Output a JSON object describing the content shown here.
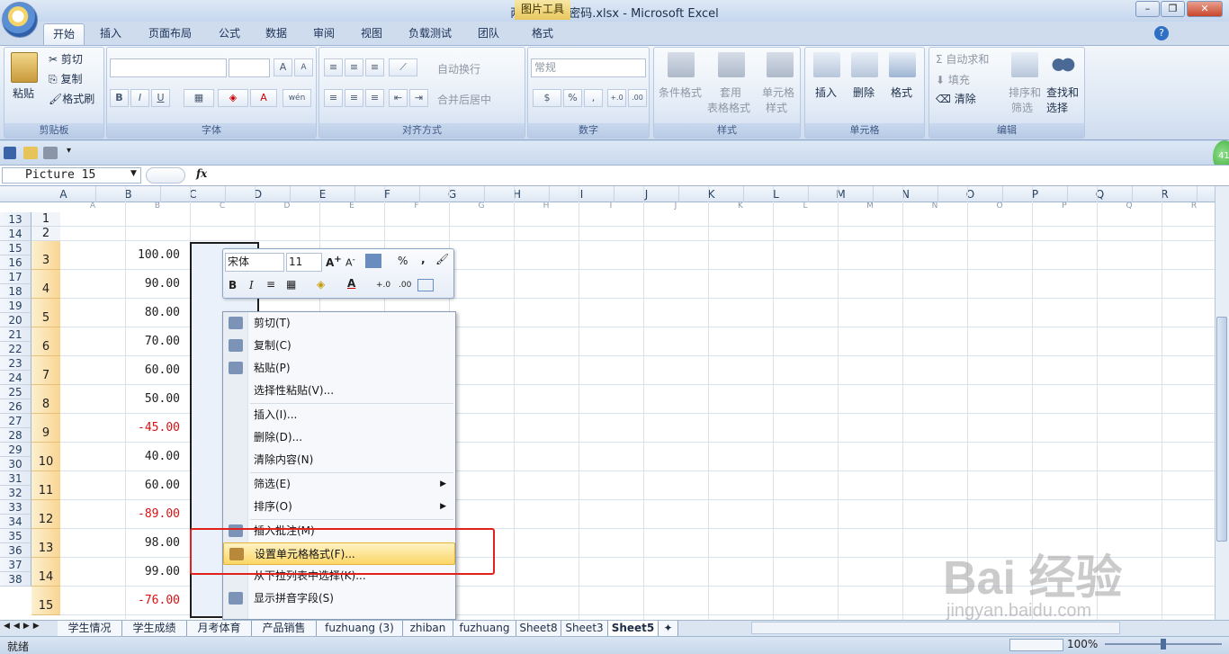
{
  "window": {
    "title": "两小无猜网密码.xlsx - Microsoft Excel",
    "context_tab_group": "图片工具",
    "min_icon": "minimize-icon",
    "max_icon": "restore-icon",
    "close_icon": "close-icon"
  },
  "tabs": [
    "开始",
    "插入",
    "页面布局",
    "公式",
    "数据",
    "审阅",
    "视图",
    "负载测试",
    "团队",
    "格式"
  ],
  "ribbon": {
    "clipboard": {
      "label": "剪贴板",
      "paste": "粘贴",
      "cut": "剪切",
      "copy": "复制",
      "format_painter": "格式刷"
    },
    "font": {
      "label": "字体",
      "bold": "B",
      "italic": "I",
      "underline": "U",
      "grow": "A",
      "shrink": "A",
      "wen": "wén"
    },
    "alignment": {
      "label": "对齐方式",
      "wrap": "自动换行",
      "merge": "合并后居中"
    },
    "number": {
      "label": "数字",
      "format": "常规",
      "percent": "%",
      "comma": ","
    },
    "styles": {
      "label": "样式",
      "conditional": "条件格式",
      "table_line1": "套用",
      "table_line2": "表格格式",
      "cell_line1": "单元格",
      "cell_line2": "样式"
    },
    "cells": {
      "label": "单元格",
      "insert": "插入",
      "delete": "删除",
      "format": "格式"
    },
    "editing": {
      "label": "编辑",
      "autosum": "自动求和",
      "fill": "填充",
      "clear": "清除",
      "sort_line1": "排序和",
      "sort_line2": "筛选",
      "find_line1": "查找和",
      "find_line2": "选择"
    }
  },
  "formula_bar": {
    "name_box": "Picture 15",
    "fx": "fx",
    "formula": ""
  },
  "columns_top": [
    "A",
    "B",
    "C",
    "D",
    "E",
    "F",
    "G",
    "H",
    "I",
    "J",
    "K",
    "L",
    "M",
    "N",
    "O",
    "P",
    "Q",
    "R"
  ],
  "columns_inner": [
    "A",
    "B",
    "C",
    "D",
    "E",
    "F",
    "G",
    "H",
    "I",
    "J",
    "K",
    "L",
    "M",
    "N",
    "O",
    "P",
    "Q",
    "R"
  ],
  "outer_rows": [
    "13",
    "14",
    "15",
    "16",
    "17",
    "18",
    "19",
    "20",
    "21",
    "22",
    "23",
    "24",
    "25",
    "26",
    "27",
    "28",
    "29",
    "30",
    "31",
    "32",
    "33",
    "34",
    "35",
    "36",
    "37",
    "38"
  ],
  "inner_rows": [
    "1",
    "2",
    "3",
    "4",
    "5",
    "6",
    "7",
    "8",
    "9",
    "10",
    "11",
    "12",
    "13",
    "14",
    "15"
  ],
  "values": [
    "100.00",
    "90.00",
    "80.00",
    "70.00",
    "60.00",
    "50.00",
    "-45.00",
    "40.00",
    "60.00",
    "-89.00",
    "98.00",
    "99.00",
    "-76.00"
  ],
  "negative_color": "#d11111",
  "mini_toolbar": {
    "font": "宋体",
    "size": "11",
    "percent": "%",
    "comma": ",",
    "bold": "B",
    "italic": "I",
    "decinc": "+.0 .00",
    "decdec": ".00 +.0"
  },
  "context_menu": [
    {
      "label": "剪切(T)",
      "icon": "scissors-icon"
    },
    {
      "label": "复制(C)",
      "icon": "copy-icon"
    },
    {
      "label": "粘贴(P)",
      "icon": "paste-icon"
    },
    {
      "label": "选择性粘贴(V)..."
    },
    {
      "label": "插入(I)..."
    },
    {
      "label": "删除(D)..."
    },
    {
      "label": "清除内容(N)"
    },
    {
      "label": "筛选(E)",
      "submenu": true
    },
    {
      "label": "排序(O)",
      "submenu": true
    },
    {
      "label": "插入批注(M)",
      "icon": "comment-icon"
    },
    {
      "label": "设置单元格格式(F)...",
      "icon": "format-cells-icon",
      "highlighted": true
    },
    {
      "label": "从下拉列表中选择(K)..."
    },
    {
      "label": "显示拼音字段(S)",
      "icon": "phonetic-icon"
    }
  ],
  "sheets": [
    "学生情况",
    "学生成绩",
    "月考体育",
    "产品销售",
    "fuzhuang (3)",
    "zhiban",
    "fuzhuang",
    "Sheet8",
    "Sheet3",
    "Sheet5"
  ],
  "active_sheet": "Sheet5",
  "status": {
    "ready": "就绪",
    "zoom": "100%"
  },
  "watermark": {
    "text": "Bai 经验",
    "url": "jingyan.baidu.com"
  },
  "badge": "41",
  "accent": "#e1221c"
}
